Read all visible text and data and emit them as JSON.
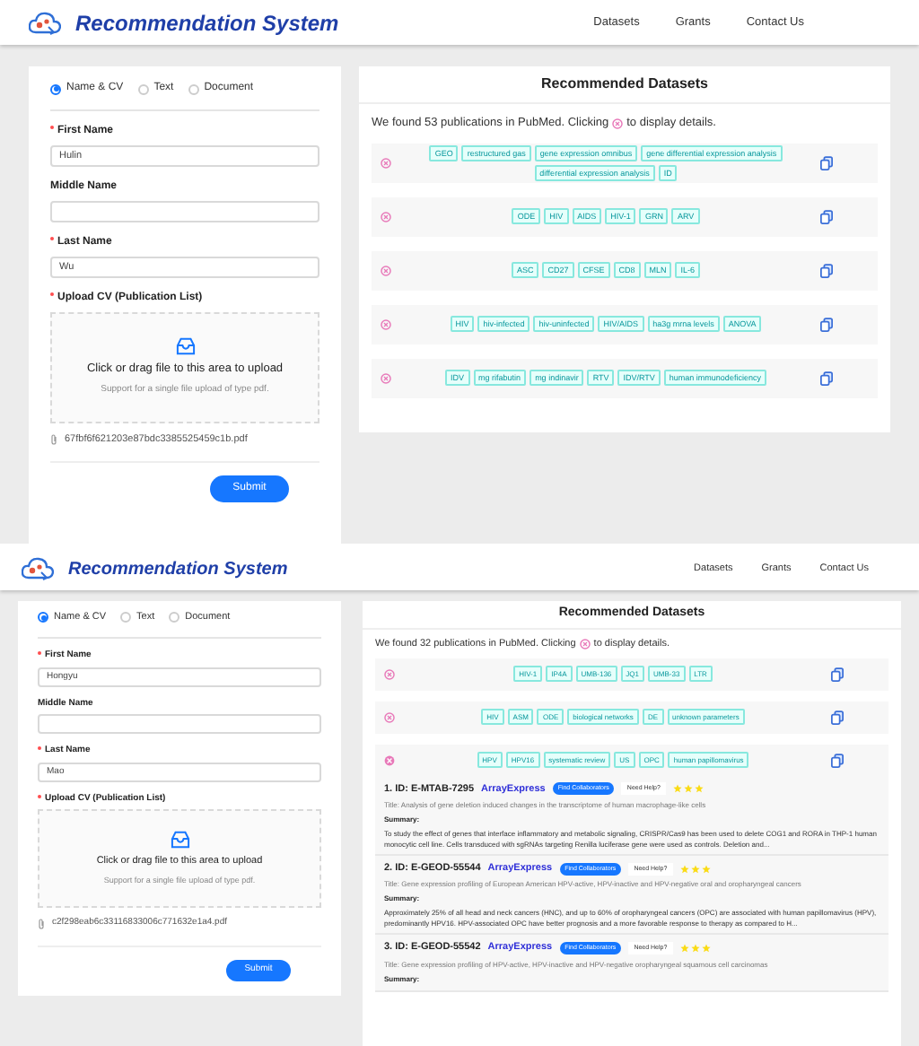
{
  "screens": [
    {
      "header": {
        "title": "Recommendation System",
        "nav": [
          {
            "label": "Datasets"
          },
          {
            "label": "Grants"
          },
          {
            "label": "Contact Us"
          }
        ]
      },
      "form": {
        "modes": [
          {
            "label": "Name & CV",
            "selected": true
          },
          {
            "label": "Text",
            "selected": false
          },
          {
            "label": "Document",
            "selected": false
          }
        ],
        "fields": [
          {
            "label": "First Name",
            "required": true,
            "value": "Hulin"
          },
          {
            "label": "Middle Name",
            "required": false
          },
          {
            "label": "Last Name",
            "required": true,
            "value": "Wu"
          }
        ],
        "upload": {
          "label": "Upload CV (Publication List)",
          "required": true,
          "prompt": "Click or drag file to this area to upload",
          "hint": "Support for a single file upload of type pdf.",
          "file": "67fbf6f621203e87bdc3385525459c1b.pdf"
        },
        "submit": "Submit"
      },
      "results": {
        "title": "Recommended Datasets",
        "intro_before": "We found 53 publications in PubMed. Clicking",
        "intro_after": "to display details.",
        "groups": [
          {
            "expanded": false,
            "tags": [
              "GEO",
              "restructured gas",
              "gene expression omnibus",
              "gene differential expression analysis",
              "differential expression analysis",
              "ID"
            ]
          },
          {
            "expanded": false,
            "tags": [
              "ODE",
              "HIV",
              "AIDS",
              "HIV-1",
              "GRN",
              "ARV"
            ]
          },
          {
            "expanded": false,
            "tags": [
              "ASC",
              "CD27",
              "CFSE",
              "CD8",
              "MLN",
              "IL-6"
            ]
          },
          {
            "expanded": false,
            "tags": [
              "HIV",
              "hiv-infected",
              "hiv-uninfected",
              "HIV/AIDS",
              "ha3g mrna levels",
              "ANOVA"
            ]
          },
          {
            "expanded": false,
            "tags": [
              "IDV",
              "mg rifabutin",
              "mg indinavir",
              "RTV",
              "IDV/RTV",
              "human immunodeficiency"
            ]
          }
        ]
      }
    },
    {
      "header": {
        "title": "Recommendation System",
        "nav": [
          {
            "label": "Datasets"
          },
          {
            "label": "Grants"
          },
          {
            "label": "Contact Us"
          }
        ]
      },
      "form": {
        "modes": [
          {
            "label": "Name & CV",
            "selected": true
          },
          {
            "label": "Text",
            "selected": false
          },
          {
            "label": "Document",
            "selected": false
          }
        ],
        "fields": [
          {
            "label": "First Name",
            "required": true,
            "value": "Hongyu"
          },
          {
            "label": "Middle Name",
            "required": false
          },
          {
            "label": "Last Name",
            "required": true,
            "value": "Mao"
          }
        ],
        "upload": {
          "label": "Upload CV (Publication List)",
          "required": true,
          "prompt": "Click or drag file to this area to upload",
          "hint": "Support for a single file upload of type pdf.",
          "file": "c2f298eab6c33116833006c771632e1a4.pdf"
        },
        "submit": "Submit"
      },
      "results": {
        "title": "Recommended Datasets",
        "intro_before": "We found 32 publications in PubMed. Clicking",
        "intro_after": "to display details.",
        "groups": [
          {
            "expanded": false,
            "tags": [
              "HIV-1",
              "IP4A",
              "UMB-136",
              "JQ1",
              "UMB-33",
              "LTR"
            ]
          },
          {
            "expanded": false,
            "tags": [
              "HIV",
              "ASM",
              "ODE",
              "biological networks",
              "DE",
              "unknown parameters"
            ]
          },
          {
            "expanded": true,
            "tags": [
              "HPV",
              "HPV16",
              "systematic review",
              "US",
              "OPC",
              "human papillomavirus"
            ],
            "items": [
              {
                "number": "1.",
                "id": "ID: E-MTAB-7295",
                "source": "ArrayExpress",
                "action": "Find Collaborators",
                "help": "Need Help?",
                "stars": 3,
                "title": "Title: Analysis of gene deletion induced changes in the transcriptome of human macrophage-like cells",
                "summary_label": "Summary:",
                "summary": "To study the effect of genes that interface inflammatory and metabolic signaling, CRISPR/Cas9 has been used to delete COG1 and RORA in THP-1 human monocytic cell line. Cells transduced with sgRNAs targeting Renilla luciferase gene were used as controls. Deletion and..."
              },
              {
                "number": "2.",
                "id": "ID: E-GEOD-55544",
                "source": "ArrayExpress",
                "action": "Find Collaborators",
                "help": "Need Help?",
                "stars": 3,
                "title": "Title: Gene expression profiling of European American HPV-active, HPV-inactive and HPV-negative oral and oropharyngeal cancers",
                "summary_label": "Summary:",
                "summary": "Approximately 25% of all head and neck cancers (HNC), and up to 60% of oropharyngeal cancers (OPC) are associated with human papillomavirus (HPV), predominantly HPV16. HPV-associated OPC have better prognosis and a more favorable response to therapy as compared to H..."
              },
              {
                "number": "3.",
                "id": "ID: E-GEOD-55542",
                "source": "ArrayExpress",
                "action": "Find Collaborators",
                "help": "Need Help?",
                "stars": 3,
                "title": "Title: Gene expression profiling of HPV-active, HPV-inactive and HPV-negative oropharyngeal squamous cell carcinomas",
                "summary_label": "Summary:"
              }
            ]
          }
        ]
      }
    }
  ]
}
